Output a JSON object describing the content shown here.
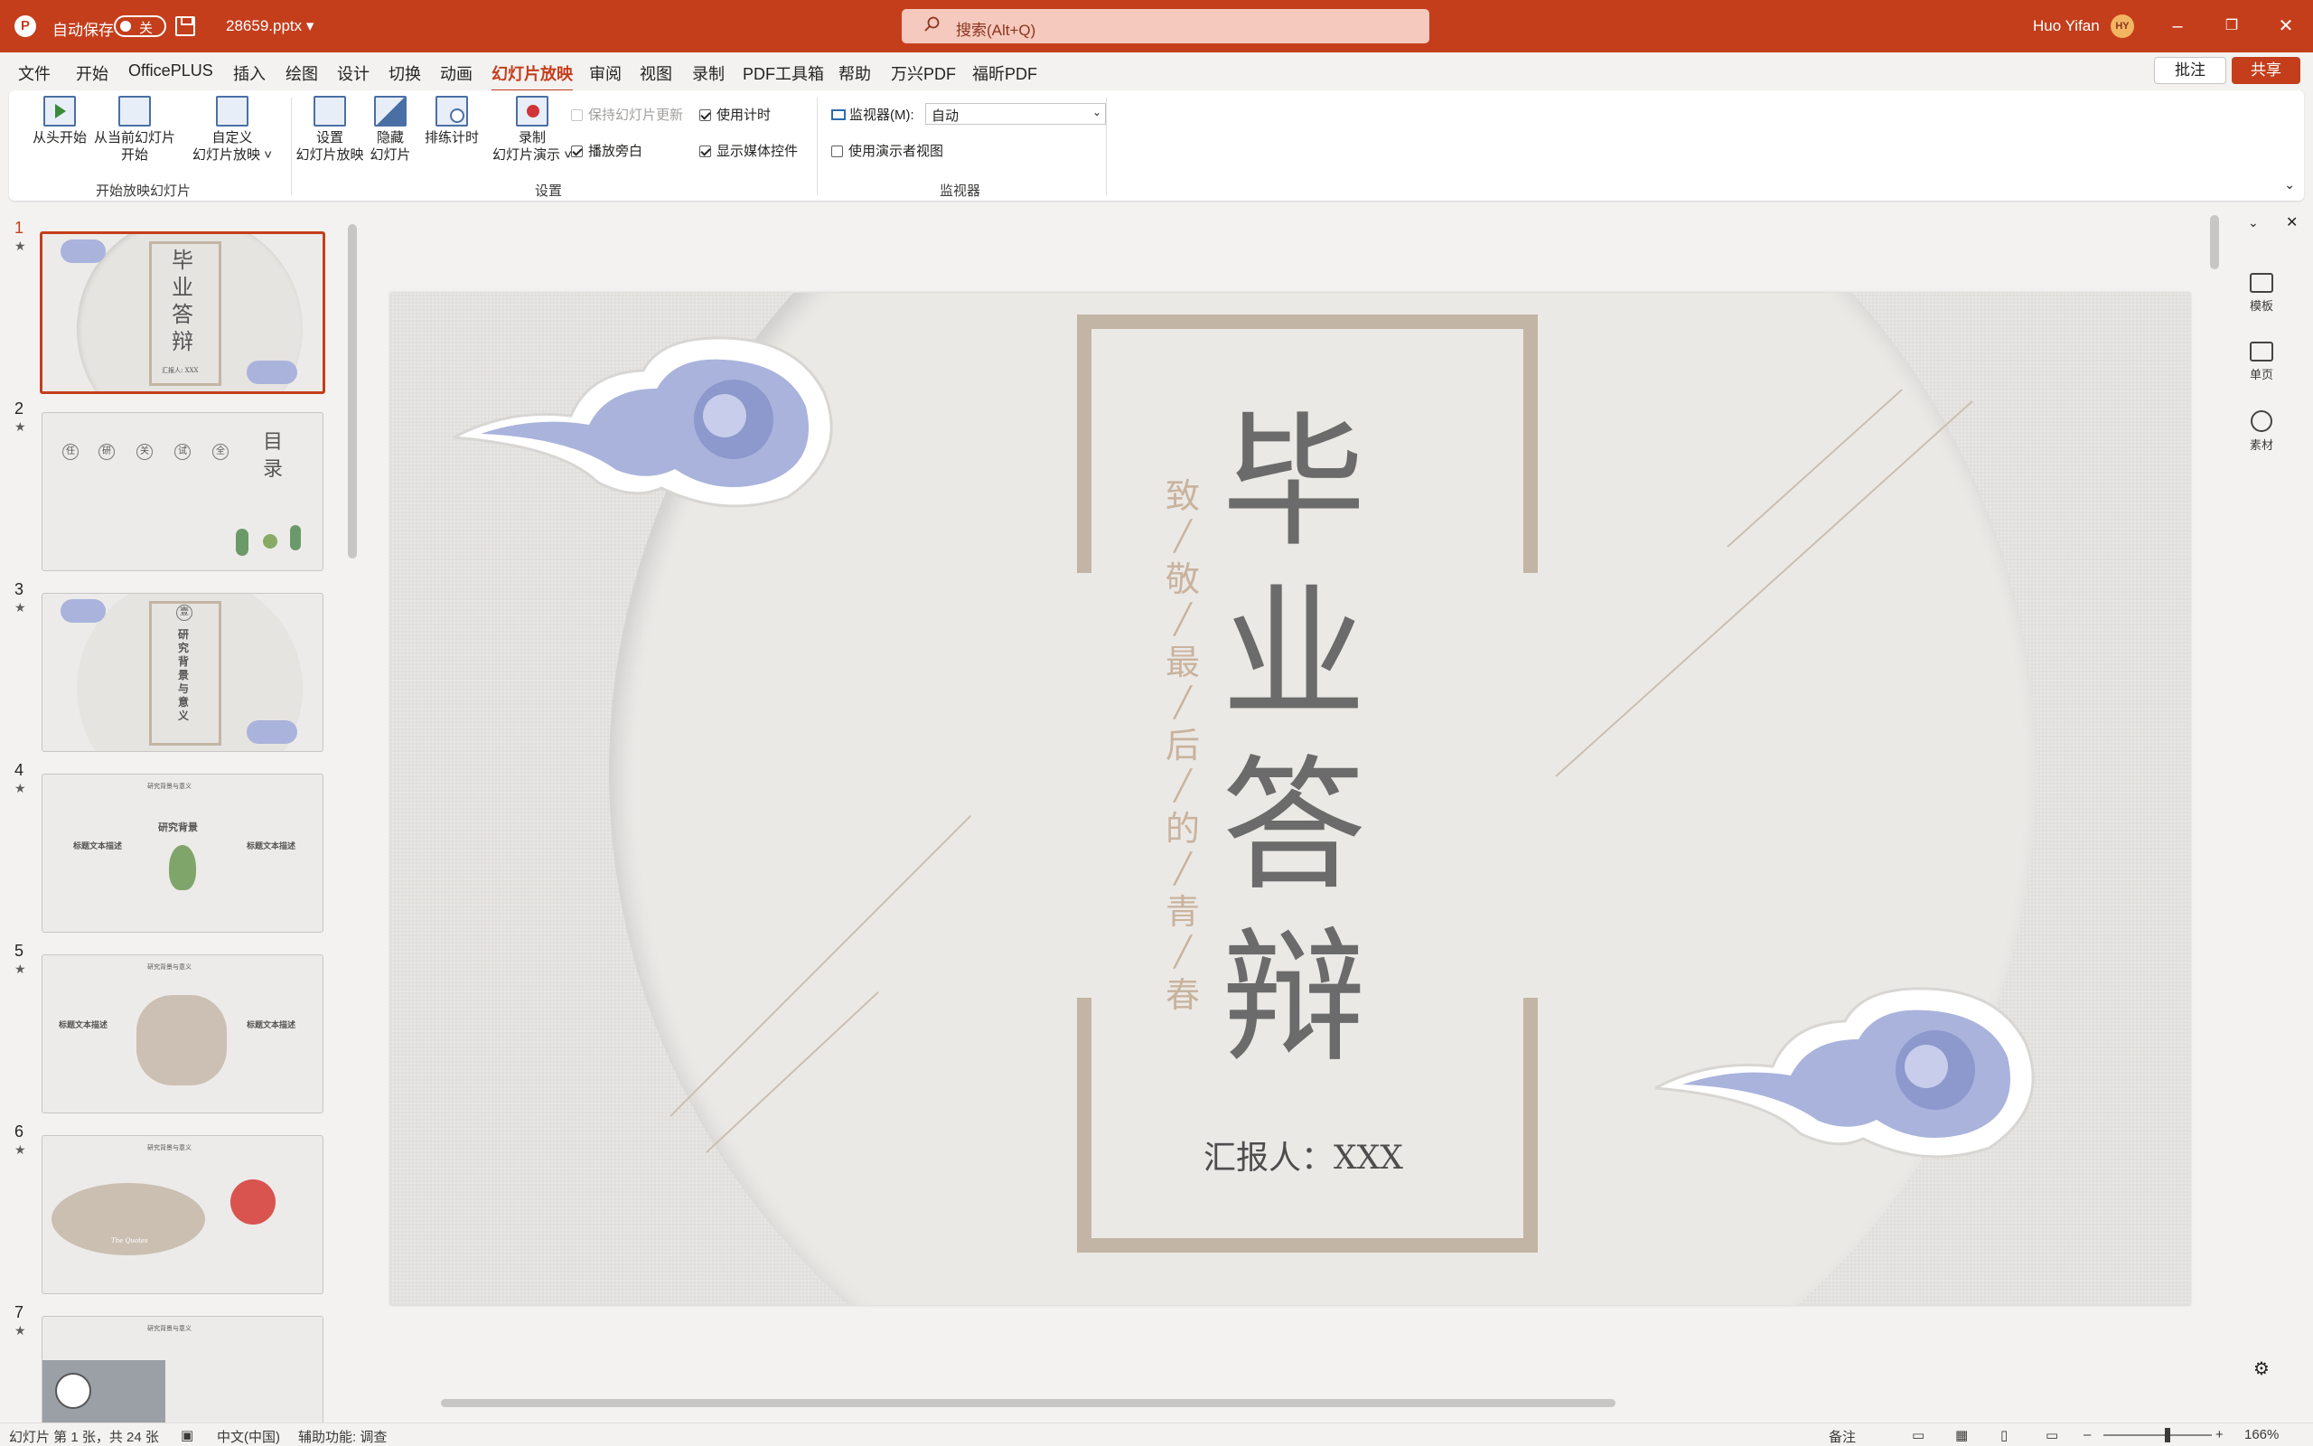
{
  "titlebar": {
    "autosave_label": "自动保存",
    "autosave_state": "关",
    "filename": "28659.pptx ▾",
    "search_placeholder": "搜索(Alt+Q)",
    "user_name": "Huo Yifan",
    "user_initials": "HY"
  },
  "tabs": [
    "文件",
    "开始",
    "OfficePLUS",
    "插入",
    "绘图",
    "设计",
    "切换",
    "动画",
    "幻灯片放映",
    "审阅",
    "视图",
    "录制",
    "PDF工具箱",
    "帮助",
    "万兴PDF",
    "福昕PDF"
  ],
  "active_tab": "幻灯片放映",
  "comment_button": "批注",
  "share_button": "共享",
  "ribbon": {
    "from_beginning": "从头开始",
    "from_current_l1": "从当前幻灯片",
    "from_current_l2": "开始",
    "custom_l1": "自定义",
    "custom_l2": "幻灯片放映 ˅",
    "group_start": "开始放映幻灯片",
    "setup_l1": "设置",
    "setup_l2": "幻灯片放映",
    "hide_l1": "隐藏",
    "hide_l2": "幻灯片",
    "rehearse": "排练计时",
    "record_l1": "录制",
    "record_l2": "幻灯片演示 ˅",
    "keep_updated": "保持幻灯片更新",
    "use_timings": "使用计时",
    "play_narrations": "播放旁白",
    "show_media_controls": "显示媒体控件",
    "group_setup": "设置",
    "monitor_label": "监视器(M):",
    "monitor_value": "自动",
    "presenter_view": "使用演示者视图",
    "group_monitor": "监视器"
  },
  "thumbnails": [
    {
      "num": "1",
      "title": "毕业答辩",
      "sub": "汇报人: XXX"
    },
    {
      "num": "2",
      "title": "目录",
      "items": [
        "任",
        "研",
        "关",
        "试",
        "全"
      ]
    },
    {
      "num": "3",
      "title": "研究背景与意义",
      "badge": "壹"
    },
    {
      "num": "4",
      "title": "研究背景",
      "header": "研究背景与意义",
      "left": "标题文本描述",
      "right": "标题文本描述"
    },
    {
      "num": "5",
      "header": "研究背景与意义",
      "left": "标题文本描述",
      "right": "标题文本描述"
    },
    {
      "num": "6",
      "header": "研究背景与意义",
      "quote": "The Quotes"
    },
    {
      "num": "7",
      "header": "研究背景与意义"
    }
  ],
  "slide": {
    "title_chars": [
      "毕",
      "业",
      "答",
      "辩"
    ],
    "vertical_chars": [
      "致",
      "敬",
      "最",
      "后",
      "的",
      "青",
      "春"
    ],
    "separator": "╱",
    "presenter": "汇报人：XXX"
  },
  "side_panel": [
    "模板",
    "单页",
    "素材"
  ],
  "status": {
    "slide_info": "幻灯片 第 1 张，共 24 张",
    "language": "中文(中国)",
    "accessibility": "辅助功能: 调查",
    "notes": "备注",
    "zoom": "166%"
  },
  "colors": {
    "accent": "#c43e1c",
    "frame": "#c2b5a5",
    "vertical_text": "#c9b39d",
    "cloud": "#9fa9d6"
  },
  "icons": [
    "powerpoint-icon",
    "save-icon",
    "search-icon",
    "minimize-icon",
    "restore-icon",
    "close-icon",
    "settings-icon"
  ]
}
